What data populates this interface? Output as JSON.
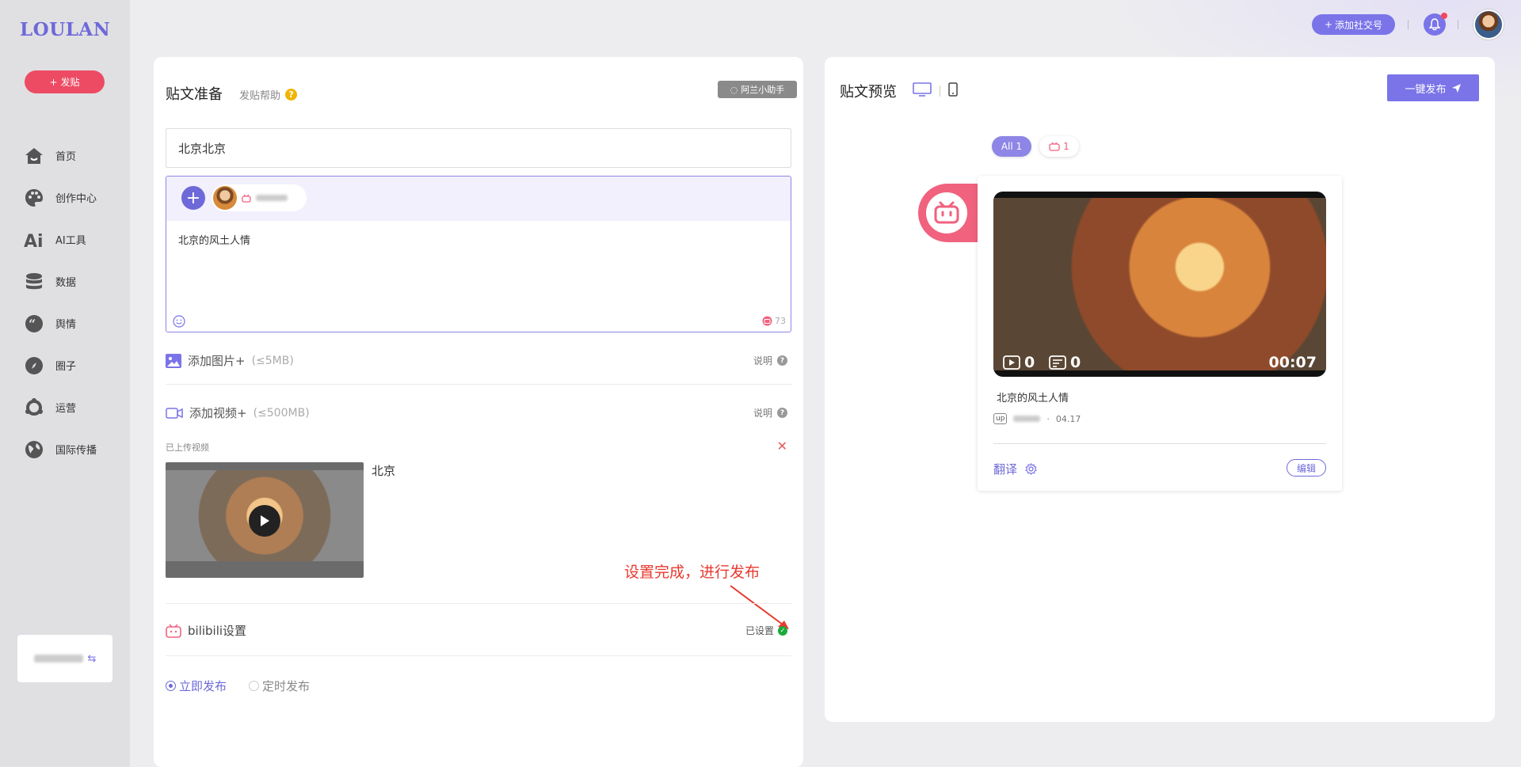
{
  "app": {
    "logo": "LOULAN"
  },
  "sidebar": {
    "post_button": "发贴",
    "items": [
      {
        "label": "首页",
        "icon": "home-icon"
      },
      {
        "label": "创作中心",
        "icon": "palette-icon"
      },
      {
        "label": "AI工具",
        "icon": "ai-icon"
      },
      {
        "label": "数据",
        "icon": "database-icon"
      },
      {
        "label": "舆情",
        "icon": "quote-icon"
      },
      {
        "label": "圈子",
        "icon": "compass-icon"
      },
      {
        "label": "运营",
        "icon": "operation-icon"
      },
      {
        "label": "国际传播",
        "icon": "globe-icon"
      }
    ]
  },
  "topbar": {
    "add_social_label": "添加社交号"
  },
  "left_panel": {
    "title": "贴文准备",
    "help_label": "发贴帮助",
    "assistant_label": "阿兰小助手",
    "title_input_value": "北京北京",
    "editor_text": "北京的风土人情",
    "char_count": "73",
    "add_image_label": "添加图片+",
    "add_image_hint": "(≤5MB)",
    "add_video_label": "添加视频+",
    "add_video_hint": "(≤500MB)",
    "note_label": "说明",
    "uploaded_label": "已上传视频",
    "video_title": "北京",
    "annotation": "设置完成，进行发布",
    "bilibili_settings_label": "bilibili设置",
    "settings_status": "已设置",
    "publish_now_label": "立即发布",
    "scheduled_label": "定时发布"
  },
  "right_panel": {
    "title": "贴文预览",
    "publish_button": "一键发布",
    "filter_all": "All 1",
    "filter_bili_count": "1",
    "preview": {
      "play_count": "0",
      "danmaku_count": "0",
      "duration": "00:07",
      "title": "北京的风土人情",
      "up_tag": "up",
      "date": "04.17",
      "translate_label": "翻译",
      "edit_label": "编辑"
    }
  },
  "colors": {
    "accent": "#7a74e8",
    "post_button": "#ec4b63",
    "bilibili_pink": "#f0627e",
    "annotation_red": "#e8392f",
    "success_green": "#1aaa3c"
  }
}
